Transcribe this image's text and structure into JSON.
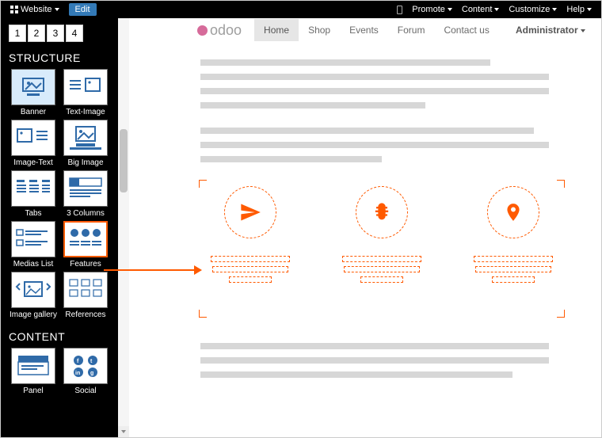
{
  "topbar": {
    "website_label": "Website",
    "edit_label": "Edit",
    "promote_label": "Promote",
    "content_label": "Content",
    "customize_label": "Customize",
    "help_label": "Help"
  },
  "editor": {
    "pager": [
      "1",
      "2",
      "3",
      "4"
    ],
    "structure_heading": "STRUCTURE",
    "content_heading": "CONTENT",
    "structure_blocks": [
      {
        "label": "Banner"
      },
      {
        "label": "Text-Image"
      },
      {
        "label": "Image-Text"
      },
      {
        "label": "Big Image"
      },
      {
        "label": "Tabs"
      },
      {
        "label": "3 Columns"
      },
      {
        "label": "Medias List"
      },
      {
        "label": "Features"
      },
      {
        "label": "Image gallery"
      },
      {
        "label": "References"
      }
    ],
    "content_blocks": [
      {
        "label": "Panel"
      },
      {
        "label": "Social"
      }
    ],
    "selected": "Features"
  },
  "site": {
    "logo_text": "odoo",
    "nav": [
      {
        "label": "Home",
        "active": true
      },
      {
        "label": "Shop"
      },
      {
        "label": "Events"
      },
      {
        "label": "Forum"
      },
      {
        "label": "Contact us"
      }
    ],
    "admin_label": "Administrator"
  },
  "colors": {
    "accent": "#ff5a00",
    "primary": "#337ab7"
  }
}
